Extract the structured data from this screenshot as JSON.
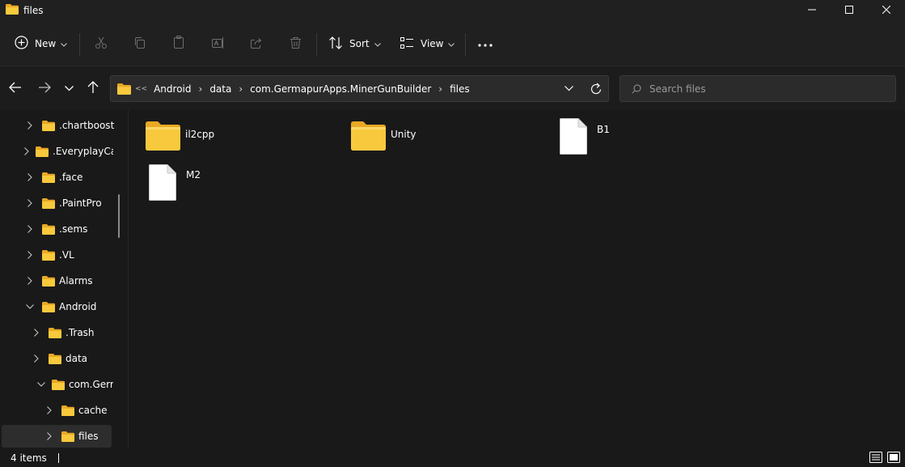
{
  "window": {
    "title": "files",
    "controls": {
      "minimize": "minimize-icon",
      "maximize": "maximize-icon",
      "close": "close-icon"
    }
  },
  "toolbar": {
    "new_label": "New",
    "sort_label": "Sort",
    "view_label": "View",
    "icons": [
      "cut-icon",
      "copy-icon",
      "paste-icon",
      "rename-icon",
      "share-icon",
      "delete-icon",
      "more-icon"
    ]
  },
  "address": {
    "overflow": "<<",
    "breadcrumbs": [
      "Android",
      "data",
      "com.GermapurApps.MinerGunBuilder",
      "files"
    ]
  },
  "search": {
    "placeholder": "Search files"
  },
  "nav_tree": [
    {
      "label": ".chartboost",
      "expanded": false
    },
    {
      "label": ".EveryplayCa",
      "expanded": false
    },
    {
      "label": ".face",
      "expanded": false
    },
    {
      "label": ".PaintPro",
      "expanded": false
    },
    {
      "label": ".sems",
      "expanded": false
    },
    {
      "label": ".VL",
      "expanded": false
    },
    {
      "label": "Alarms",
      "expanded": false
    },
    {
      "label": "Android",
      "expanded": true
    },
    {
      "label": ".Trash",
      "expanded": false
    },
    {
      "label": "data",
      "expanded": false
    },
    {
      "label": "com.Germ",
      "expanded": true
    },
    {
      "label": "cache",
      "expanded": false
    },
    {
      "label": "files",
      "expanded": false,
      "selected": true
    }
  ],
  "files": [
    {
      "name": "il2cpp",
      "type": "folder"
    },
    {
      "name": "Unity",
      "type": "folder"
    },
    {
      "name": "B1",
      "type": "file"
    },
    {
      "name": "M2",
      "type": "file"
    }
  ],
  "status": {
    "item_count": "4 items"
  },
  "colors": {
    "background": "#191919",
    "chrome": "#202020",
    "folder": "#f4c247",
    "accent": "#ffffff"
  }
}
